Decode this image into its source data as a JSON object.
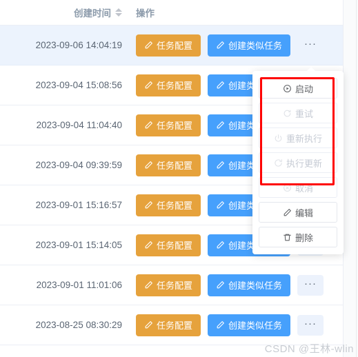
{
  "table": {
    "columns": [
      {
        "key": "create_time",
        "label": "创建时间",
        "sortable": true,
        "sort_icon": "sort-caret-icon"
      },
      {
        "key": "operation",
        "label": "操作",
        "sortable": false
      }
    ],
    "rows": [
      {
        "create_time": "2023-09-06 14:04:19",
        "highlighted": true
      },
      {
        "create_time": "2023-09-04 15:08:56",
        "highlighted": false
      },
      {
        "create_time": "2023-09-04 11:04:40",
        "highlighted": false
      },
      {
        "create_time": "2023-09-04 09:39:59",
        "highlighted": false
      },
      {
        "create_time": "2023-09-01 15:16:57",
        "highlighted": false
      },
      {
        "create_time": "2023-09-01 15:14:05",
        "highlighted": false
      },
      {
        "create_time": "2023-09-01 11:01:06",
        "highlighted": false
      },
      {
        "create_time": "2023-08-25 08:30:29",
        "highlighted": false
      }
    ],
    "row_actions": {
      "config_label": "任务配置",
      "config_icon": "edit-pencil-icon",
      "config_color": "#e6a23c",
      "similar_label": "创建类似任务",
      "similar_icon": "edit-pencil-icon",
      "similar_color": "#46a0fc",
      "more_label": "···",
      "more_icon": "ellipsis-icon"
    }
  },
  "dropdown": {
    "open_for_row": 1,
    "items": [
      {
        "label": "启动",
        "icon": "play-circle-icon",
        "disabled": false
      },
      {
        "label": "重试",
        "icon": "refresh-icon",
        "disabled": true
      },
      {
        "label": "重新执行",
        "icon": "power-icon",
        "disabled": true
      },
      {
        "label": "执行更新",
        "icon": "refresh-circle-icon",
        "disabled": true
      },
      {
        "label": "取消",
        "icon": "circle-close-icon",
        "disabled": true
      },
      {
        "label": "编辑",
        "icon": "edit-pencil-icon",
        "disabled": false
      },
      {
        "label": "删除",
        "icon": "trash-icon",
        "disabled": false
      }
    ]
  },
  "annotation": {
    "shape": "rectangle",
    "color": "#fe0000",
    "covers_items": [
      "启动",
      "重试",
      "重新执行",
      "执行更新"
    ]
  },
  "watermark": {
    "text": "CSDN @王林-wlin"
  }
}
